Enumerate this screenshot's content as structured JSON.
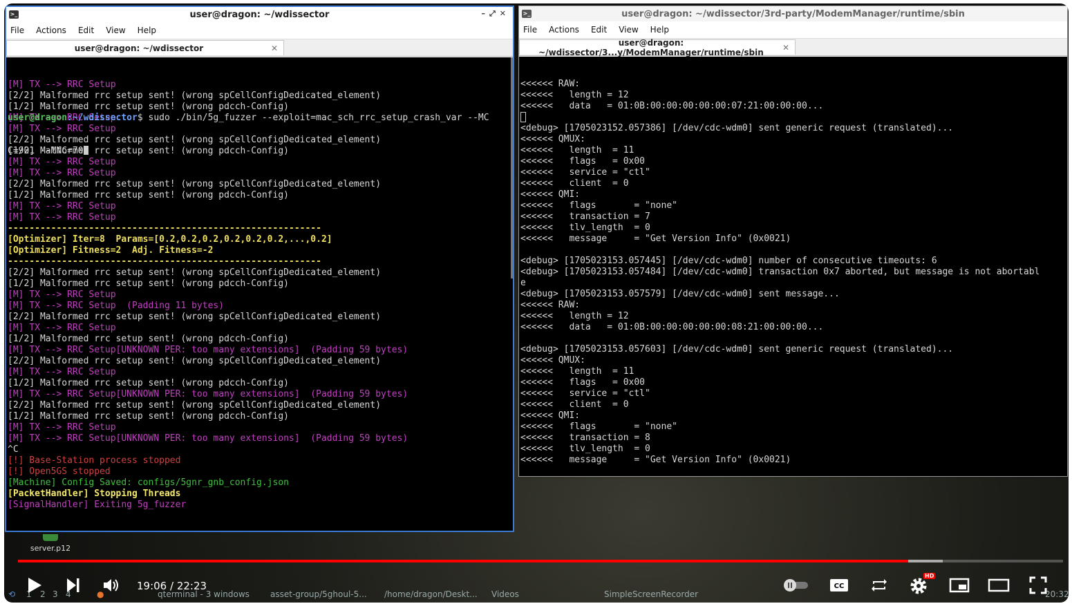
{
  "left_window": {
    "title": "user@dragon: ~/wdissector",
    "menu": [
      "File",
      "Actions",
      "Edit",
      "View",
      "Help"
    ],
    "tab_label": "user@dragon: ~/wdissector",
    "lines": [
      {
        "t": "[M] TX --> RRC Setup",
        "c": "m"
      },
      {
        "t": "[2/2] Malformed rrc setup sent! (wrong spCellConfigDedicated_element)",
        "c": "w"
      },
      {
        "t": "[1/2] Malformed rrc setup sent! (wrong pdcch-Config)",
        "c": "w"
      },
      {
        "t": "[M] TX --> RRC Setup",
        "c": "m"
      },
      {
        "t": "[M] TX --> RRC Setup",
        "c": "m"
      },
      {
        "t": "[2/2] Malformed rrc setup sent! (wrong spCellConfigDedicated_element)",
        "c": "w"
      },
      {
        "t": "[1/2] Malformed rrc setup sent! (wrong pdcch-Config)",
        "c": "w"
      },
      {
        "t": "[M] TX --> RRC Setup",
        "c": "m"
      },
      {
        "t": "[M] TX --> RRC Setup",
        "c": "m"
      },
      {
        "t": "[2/2] Malformed rrc setup sent! (wrong spCellConfigDedicated_element)",
        "c": "w"
      },
      {
        "t": "[1/2] Malformed rrc setup sent! (wrong pdcch-Config)",
        "c": "w"
      },
      {
        "t": "[M] TX --> RRC Setup",
        "c": "m"
      },
      {
        "t": "[M] TX --> RRC Setup",
        "c": "m"
      },
      {
        "t": "----------------------------------------------------------",
        "c": "y"
      },
      {
        "t": "[Optimizer] Iter=8  Params=[0.2,0.2,0.2,0.2,0.2,0.2,...,0.2]",
        "c": "y"
      },
      {
        "t": "[Optimizer] Fitness=2  Adj. Fitness=-2",
        "c": "y"
      },
      {
        "t": "----------------------------------------------------------",
        "c": "y"
      },
      {
        "t": "[2/2] Malformed rrc setup sent! (wrong spCellConfigDedicated_element)",
        "c": "w"
      },
      {
        "t": "[1/2] Malformed rrc setup sent! (wrong pdcch-Config)",
        "c": "w"
      },
      {
        "t": "[M] TX --> RRC Setup",
        "c": "m"
      },
      {
        "t": "[M] TX --> RRC Setup  (Padding 11 bytes)",
        "c": "m"
      },
      {
        "t": "[2/2] Malformed rrc setup sent! (wrong spCellConfigDedicated_element)",
        "c": "w"
      },
      {
        "t": "[M] TX --> RRC Setup",
        "c": "m"
      },
      {
        "t": "[1/2] Malformed rrc setup sent! (wrong pdcch-Config)",
        "c": "w"
      },
      {
        "t": "[M] TX --> RRC Setup[UNKNOWN PER: too many extensions]  (Padding 59 bytes)",
        "c": "m"
      },
      {
        "t": "[2/2] Malformed rrc setup sent! (wrong spCellConfigDedicated_element)",
        "c": "w"
      },
      {
        "t": "[M] TX --> RRC Setup",
        "c": "m"
      },
      {
        "t": "[1/2] Malformed rrc setup sent! (wrong pdcch-Config)",
        "c": "w"
      },
      {
        "t": "[M] TX --> RRC Setup[UNKNOWN PER: too many extensions]  (Padding 59 bytes)",
        "c": "m"
      },
      {
        "t": "[2/2] Malformed rrc setup sent! (wrong spCellConfigDedicated_element)",
        "c": "w"
      },
      {
        "t": "[1/2] Malformed rrc setup sent! (wrong pdcch-Config)",
        "c": "w"
      },
      {
        "t": "[M] TX --> RRC Setup",
        "c": "m"
      },
      {
        "t": "[M] TX --> RRC Setup[UNKNOWN PER: too many extensions]  (Padding 59 bytes)",
        "c": "m"
      },
      {
        "t": "^C",
        "c": "w"
      },
      {
        "t": "[!] Base-Station process stopped",
        "c": "r"
      },
      {
        "t": "[!] Open5GS stopped",
        "c": "r"
      },
      {
        "t": "[Machine] Config Saved: configs/5gnr_gnb_config.json",
        "c": "g"
      },
      {
        "t": "[PacketHandler] Stopping Threads",
        "c": "yb"
      },
      {
        "t": "[SignalHandler] Exiting 5g_fuzzer",
        "c": "m"
      },
      {
        "t": "",
        "c": "w"
      }
    ],
    "prompt_user": "user@dragon",
    "prompt_path": ":~/wdissector",
    "prompt_cmd": "$ sudo ./bin/5g_fuzzer --exploit=mac_sch_rrc_setup_crash_var --MC",
    "prompt_cont": "C=901 --MNC=70"
  },
  "right_window": {
    "title": "user@dragon: ~/wdissector/3rd-party/ModemManager/runtime/sbin",
    "menu": [
      "File",
      "Actions",
      "Edit",
      "View",
      "Help"
    ],
    "tab_label": "user@dragon: ~/wdissector/3...y/ModemManager/runtime/sbin",
    "lines": [
      "<<<<<< RAW:",
      "<<<<<<   length = 12",
      "<<<<<<   data   = 01:0B:00:00:00:00:00:07:21:00:00:00...",
      "",
      "<debug> [1705023152.057386] [/dev/cdc-wdm0] sent generic request (translated)...",
      "<<<<<< QMUX:",
      "<<<<<<   length  = 11",
      "<<<<<<   flags   = 0x00",
      "<<<<<<   service = \"ctl\"",
      "<<<<<<   client  = 0",
      "<<<<<< QMI:",
      "<<<<<<   flags       = \"none\"",
      "<<<<<<   transaction = 7",
      "<<<<<<   tlv_length  = 0",
      "<<<<<<   message     = \"Get Version Info\" (0x0021)",
      "",
      "<debug> [1705023153.057445] [/dev/cdc-wdm0] number of consecutive timeouts: 6",
      "<debug> [1705023153.057484] [/dev/cdc-wdm0] transaction 0x7 aborted, but message is not abortabl",
      "e",
      "<debug> [1705023153.057579] [/dev/cdc-wdm0] sent message...",
      "<<<<<< RAW:",
      "<<<<<<   length = 12",
      "<<<<<<   data   = 01:0B:00:00:00:00:00:08:21:00:00:00...",
      "",
      "<debug> [1705023153.057603] [/dev/cdc-wdm0] sent generic request (translated)...",
      "<<<<<< QMUX:",
      "<<<<<<   length  = 11",
      "<<<<<<   flags   = 0x00",
      "<<<<<<   service = \"ctl\"",
      "<<<<<<   client  = 0",
      "<<<<<< QMI:",
      "<<<<<<   flags       = \"none\"",
      "<<<<<<   transaction = 8",
      "<<<<<<   tlv_length  = 0",
      "<<<<<<   message     = \"Get Version Info\" (0x0021)",
      "",
      ""
    ]
  },
  "desktop": {
    "icon_label": "server.p12"
  },
  "player": {
    "time": "19:06 / 22:23",
    "progress_played": 0.852,
    "progress_buffered": 0.885,
    "hd_badge": "HD",
    "colors": {
      "played": "#ff0000"
    }
  },
  "taskbar": {
    "workspaces": [
      "1",
      "2",
      "3",
      "4"
    ],
    "items": [
      "qterminal - 3 windows",
      "asset-group/5ghoul-5...",
      "/home/dragon/Deskt...",
      "Videos",
      "SimpleScreenRecorder"
    ],
    "clock": "20:32"
  }
}
